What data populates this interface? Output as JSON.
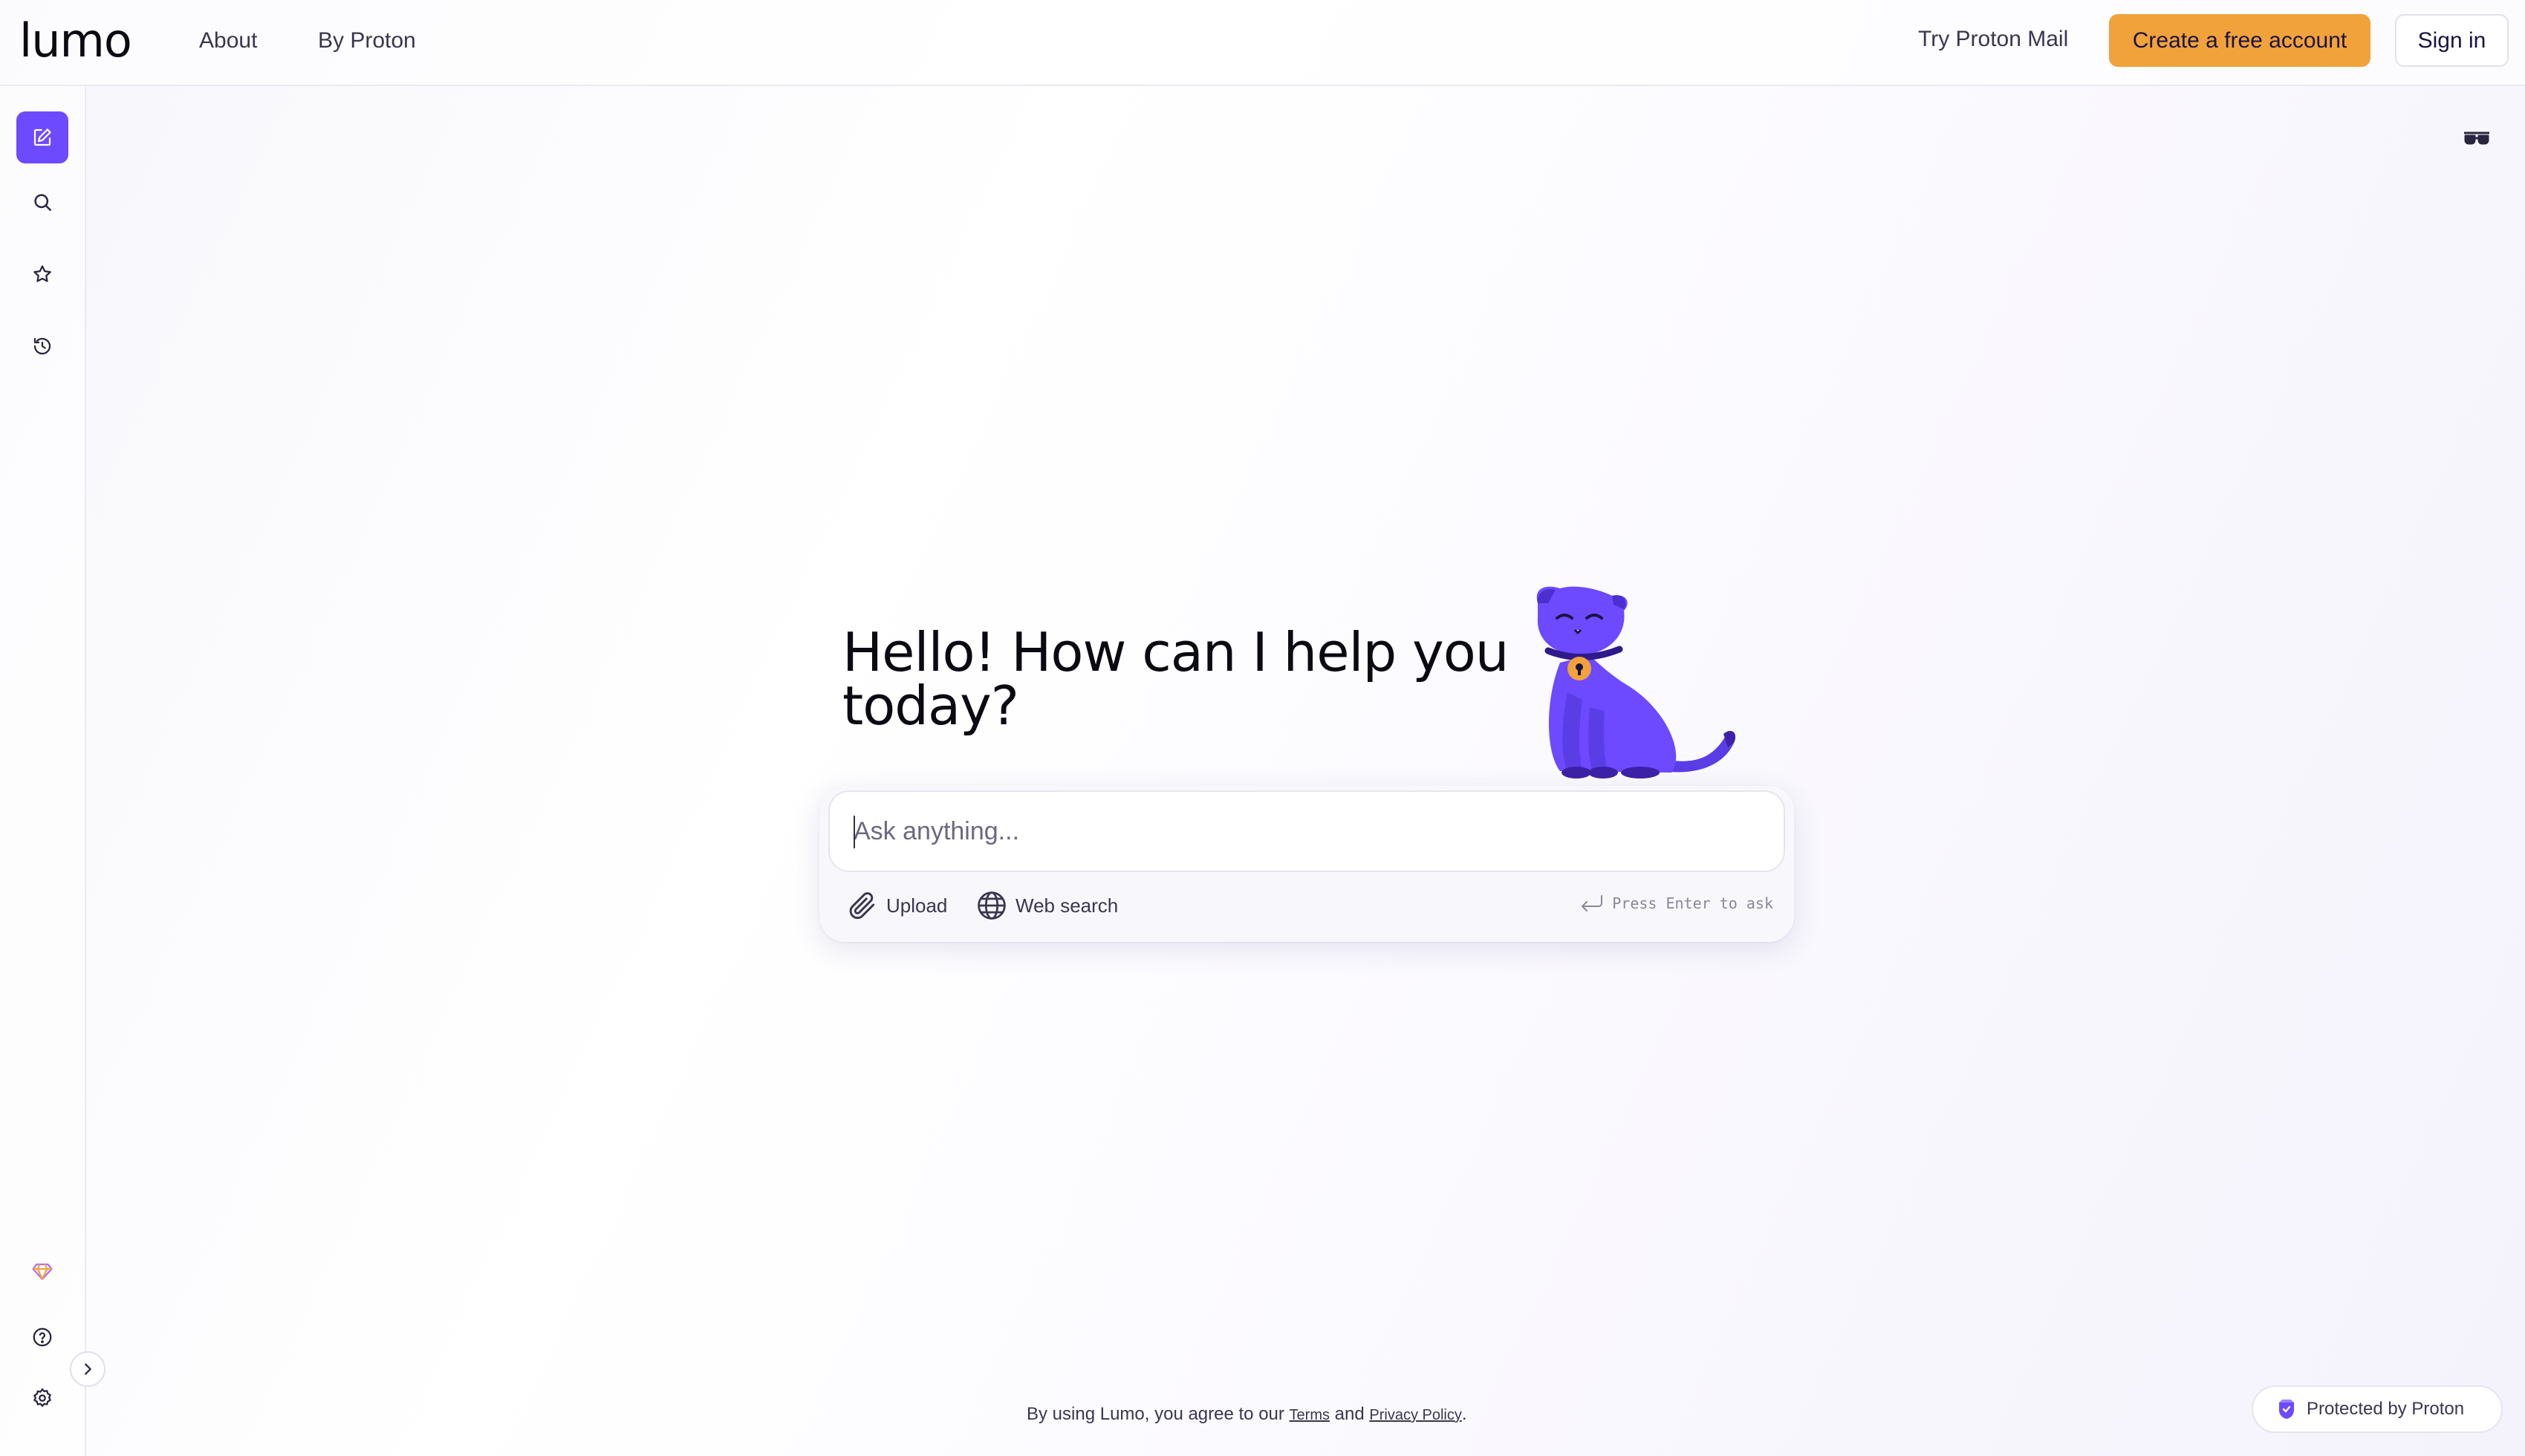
{
  "header": {
    "logo": "lumo",
    "nav": [
      "About",
      "By Proton"
    ],
    "try_mail": "Try Proton Mail",
    "create_account": "Create a free account",
    "sign_in": "Sign in"
  },
  "sidebar": {
    "items": [
      {
        "name": "new-chat",
        "icon": "edit-icon",
        "active": true
      },
      {
        "name": "search",
        "icon": "search-icon"
      },
      {
        "name": "favorites",
        "icon": "star-icon"
      },
      {
        "name": "history",
        "icon": "history-icon"
      }
    ],
    "bottom": [
      {
        "name": "upgrade",
        "icon": "diamond-icon"
      },
      {
        "name": "help",
        "icon": "help-icon"
      },
      {
        "name": "settings",
        "icon": "gear-icon"
      }
    ]
  },
  "main": {
    "greeting": "Hello! How can I help you today?",
    "composer": {
      "placeholder": "Ask anything...",
      "value": "",
      "upload_label": "Upload",
      "web_search_label": "Web search",
      "hint": "Press Enter to ask"
    }
  },
  "footer": {
    "prefix": "By using Lumo, you agree to our ",
    "terms": "Terms",
    "and": " and ",
    "privacy": "Privacy Policy",
    "suffix": ".",
    "protected": "Protected by Proton"
  },
  "colors": {
    "accent": "#6d4aff",
    "cta": "#f1a23a",
    "text": "#1b1340"
  }
}
